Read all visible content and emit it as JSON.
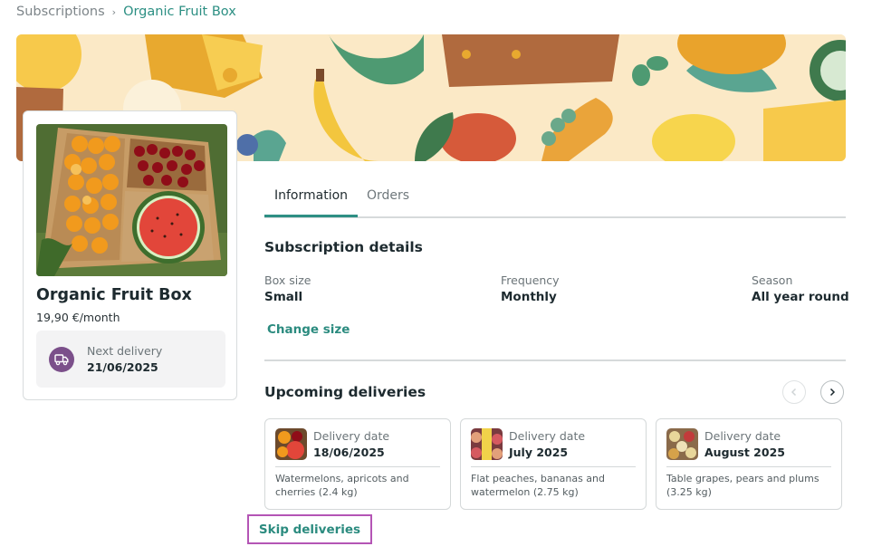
{
  "breadcrumb": {
    "parent": "Subscriptions",
    "current": "Organic Fruit Box"
  },
  "product": {
    "name": "Organic Fruit Box",
    "price": "19,90 €/month",
    "next_delivery_label": "Next delivery",
    "next_delivery_date": "21/06/2025"
  },
  "tabs": [
    {
      "label": "Information",
      "active": true
    },
    {
      "label": "Orders",
      "active": false
    }
  ],
  "details": {
    "title": "Subscription details",
    "box_size_label": "Box size",
    "box_size_value": "Small",
    "frequency_label": "Frequency",
    "frequency_value": "Monthly",
    "season_label": "Season",
    "season_value": "All year round",
    "change_size": "Change size"
  },
  "upcoming": {
    "title": "Upcoming deliveries",
    "date_label": "Delivery date",
    "items": [
      {
        "date": "18/06/2025",
        "description": "Watermelons, apricots and cherries (2.4 kg)"
      },
      {
        "date": "July 2025",
        "description": "Flat peaches, bananas and watermelon (2.75 kg)"
      },
      {
        "date": "August 2025",
        "description": "Table grapes, pears and plums (3.25 kg)"
      }
    ],
    "skip_label": "Skip deliveries"
  },
  "icons": {
    "breadcrumb_separator": "chevron-right-icon",
    "prev": "chevron-left-icon",
    "next": "chevron-right-icon",
    "truck": "truck-icon"
  },
  "colors": {
    "accent": "#2b8b7f",
    "truck_bg": "#7b4f8a",
    "highlight": "#b455b5"
  }
}
